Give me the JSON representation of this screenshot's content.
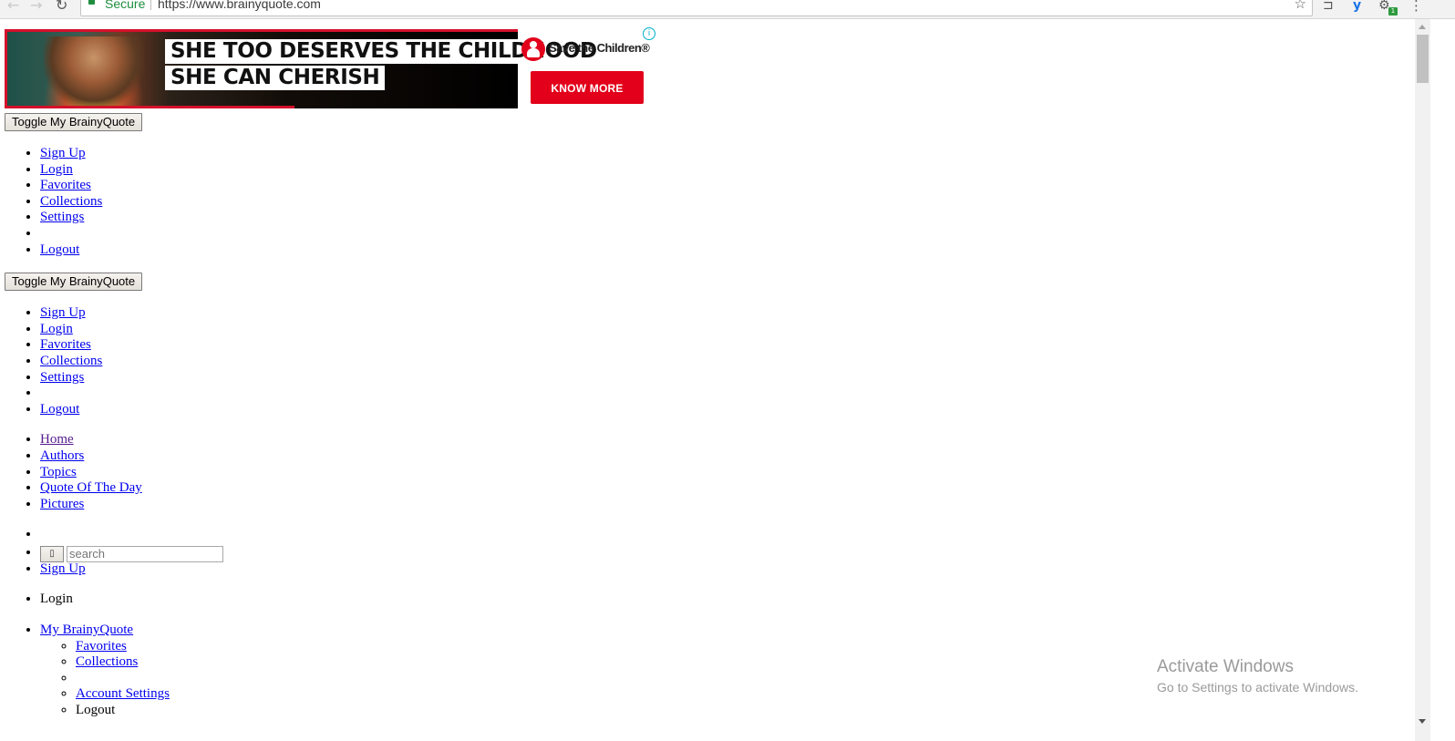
{
  "browser": {
    "secure_label": "Secure",
    "url": "https://www.brainyquote.com",
    "nav_back_icon": "←",
    "nav_forward_icon": "→",
    "reload_icon": "↻",
    "bookmark_icon": "☆",
    "cast_icon": "⊐",
    "extension_y_icon": "y",
    "extension_gear_icon": "⚙",
    "extension_badge": "1",
    "menu_icon": "⋮"
  },
  "ad": {
    "headline_line1": "SHE TOO DESERVES THE CHILDHOOD",
    "headline_line2": "SHE CAN CHERISH",
    "brand": "Save the Children®",
    "cta": "KNOW MORE",
    "info_icon": "i",
    "brand_color": "#e2001a"
  },
  "my_brainyquote_block_1": {
    "toggle_label": "Toggle My BrainyQuote",
    "items": [
      {
        "label": "Sign Up"
      },
      {
        "label": "Login"
      },
      {
        "label": "Favorites"
      },
      {
        "label": "Collections"
      },
      {
        "label": "Settings"
      },
      {
        "label": ""
      },
      {
        "label": "Logout"
      }
    ]
  },
  "my_brainyquote_block_2": {
    "toggle_label": "Toggle My BrainyQuote",
    "items": [
      {
        "label": "Sign Up"
      },
      {
        "label": "Login"
      },
      {
        "label": "Favorites"
      },
      {
        "label": "Collections"
      },
      {
        "label": "Settings"
      },
      {
        "label": ""
      },
      {
        "label": "Logout"
      }
    ]
  },
  "main_nav": {
    "items": [
      {
        "label": "Home"
      },
      {
        "label": "Authors"
      },
      {
        "label": "Topics"
      },
      {
        "label": "Quote Of The Day"
      },
      {
        "label": "Pictures"
      }
    ]
  },
  "search": {
    "button_icon": "▯",
    "placeholder": "search",
    "value": ""
  },
  "account_nav": {
    "sign_up": "Sign Up",
    "login": "Login",
    "my_brainyquote": "My BrainyQuote",
    "sub_items": {
      "favorites": "Favorites",
      "collections": "Collections",
      "account_settings": "Account Settings",
      "logout": "Logout"
    }
  },
  "watermark": {
    "title": "Activate Windows",
    "subtitle": "Go to Settings to activate Windows."
  }
}
